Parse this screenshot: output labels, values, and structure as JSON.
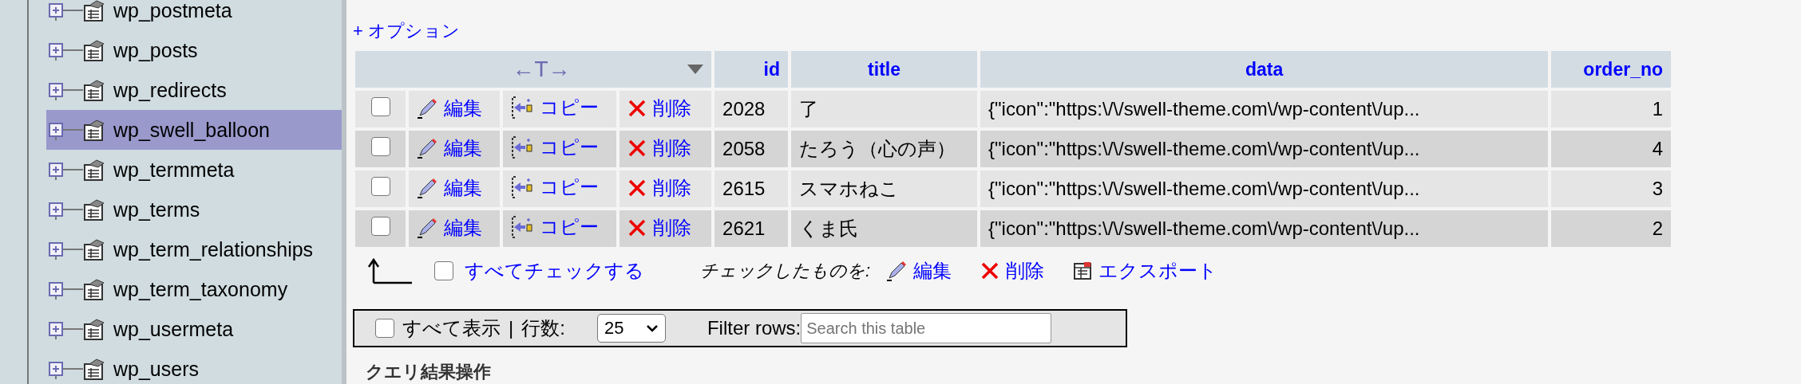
{
  "sidebar": {
    "items": [
      {
        "label": "wp_postmeta",
        "selected": false
      },
      {
        "label": "wp_posts",
        "selected": false
      },
      {
        "label": "wp_redirects",
        "selected": false
      },
      {
        "label": "wp_swell_balloon",
        "selected": true
      },
      {
        "label": "wp_termmeta",
        "selected": false
      },
      {
        "label": "wp_terms",
        "selected": false
      },
      {
        "label": "wp_term_relationships",
        "selected": false
      },
      {
        "label": "wp_term_taxonomy",
        "selected": false
      },
      {
        "label": "wp_usermeta",
        "selected": false
      },
      {
        "label": "wp_users",
        "selected": false
      }
    ]
  },
  "options_link": "+ オプション",
  "table": {
    "header_toggle": "←T→",
    "columns": [
      "id",
      "title",
      "data",
      "order_no"
    ],
    "rows": [
      {
        "checked": false,
        "actions": [
          {
            "kind": "edit",
            "label": "編集"
          },
          {
            "kind": "copy",
            "label": "コピー"
          },
          {
            "kind": "delete",
            "label": "削除"
          }
        ],
        "cells": [
          "2028",
          "了",
          "{\"icon\":\"https:\\/\\/swell-theme.com\\/wp-content\\/up...",
          "1"
        ]
      },
      {
        "checked": false,
        "actions": [
          {
            "kind": "edit",
            "label": "編集"
          },
          {
            "kind": "copy",
            "label": "コピー"
          },
          {
            "kind": "delete",
            "label": "削除"
          }
        ],
        "cells": [
          "2058",
          "たろう（心の声）",
          "{\"icon\":\"https:\\/\\/swell-theme.com\\/wp-content\\/up...",
          "4"
        ]
      },
      {
        "checked": false,
        "actions": [
          {
            "kind": "edit",
            "label": "編集"
          },
          {
            "kind": "copy",
            "label": "コピー"
          },
          {
            "kind": "delete",
            "label": "削除"
          }
        ],
        "cells": [
          "2615",
          "スマホねこ",
          "{\"icon\":\"https:\\/\\/swell-theme.com\\/wp-content\\/up...",
          "3"
        ]
      },
      {
        "checked": false,
        "actions": [
          {
            "kind": "edit",
            "label": "編集"
          },
          {
            "kind": "copy",
            "label": "コピー"
          },
          {
            "kind": "delete",
            "label": "削除"
          }
        ],
        "cells": [
          "2621",
          "くま氏",
          "{\"icon\":\"https:\\/\\/swell-theme.com\\/wp-content\\/up...",
          "2"
        ]
      }
    ]
  },
  "bulk": {
    "check_all": {
      "label": "すべてチェックする",
      "checked": false
    },
    "with_selected": "チェックしたものを:",
    "actions": [
      {
        "kind": "edit",
        "label": "編集"
      },
      {
        "kind": "delete",
        "label": "削除"
      },
      {
        "kind": "export",
        "label": "エクスポート"
      }
    ]
  },
  "filter_bar": {
    "show_all": {
      "label": "すべて表示",
      "checked": false
    },
    "separator": "|",
    "rows_label": "行数:",
    "rows_value": "25",
    "filter_label": "Filter rows:",
    "search": {
      "placeholder": "Search this table"
    }
  },
  "section_heading": "クエリ結果操作"
}
